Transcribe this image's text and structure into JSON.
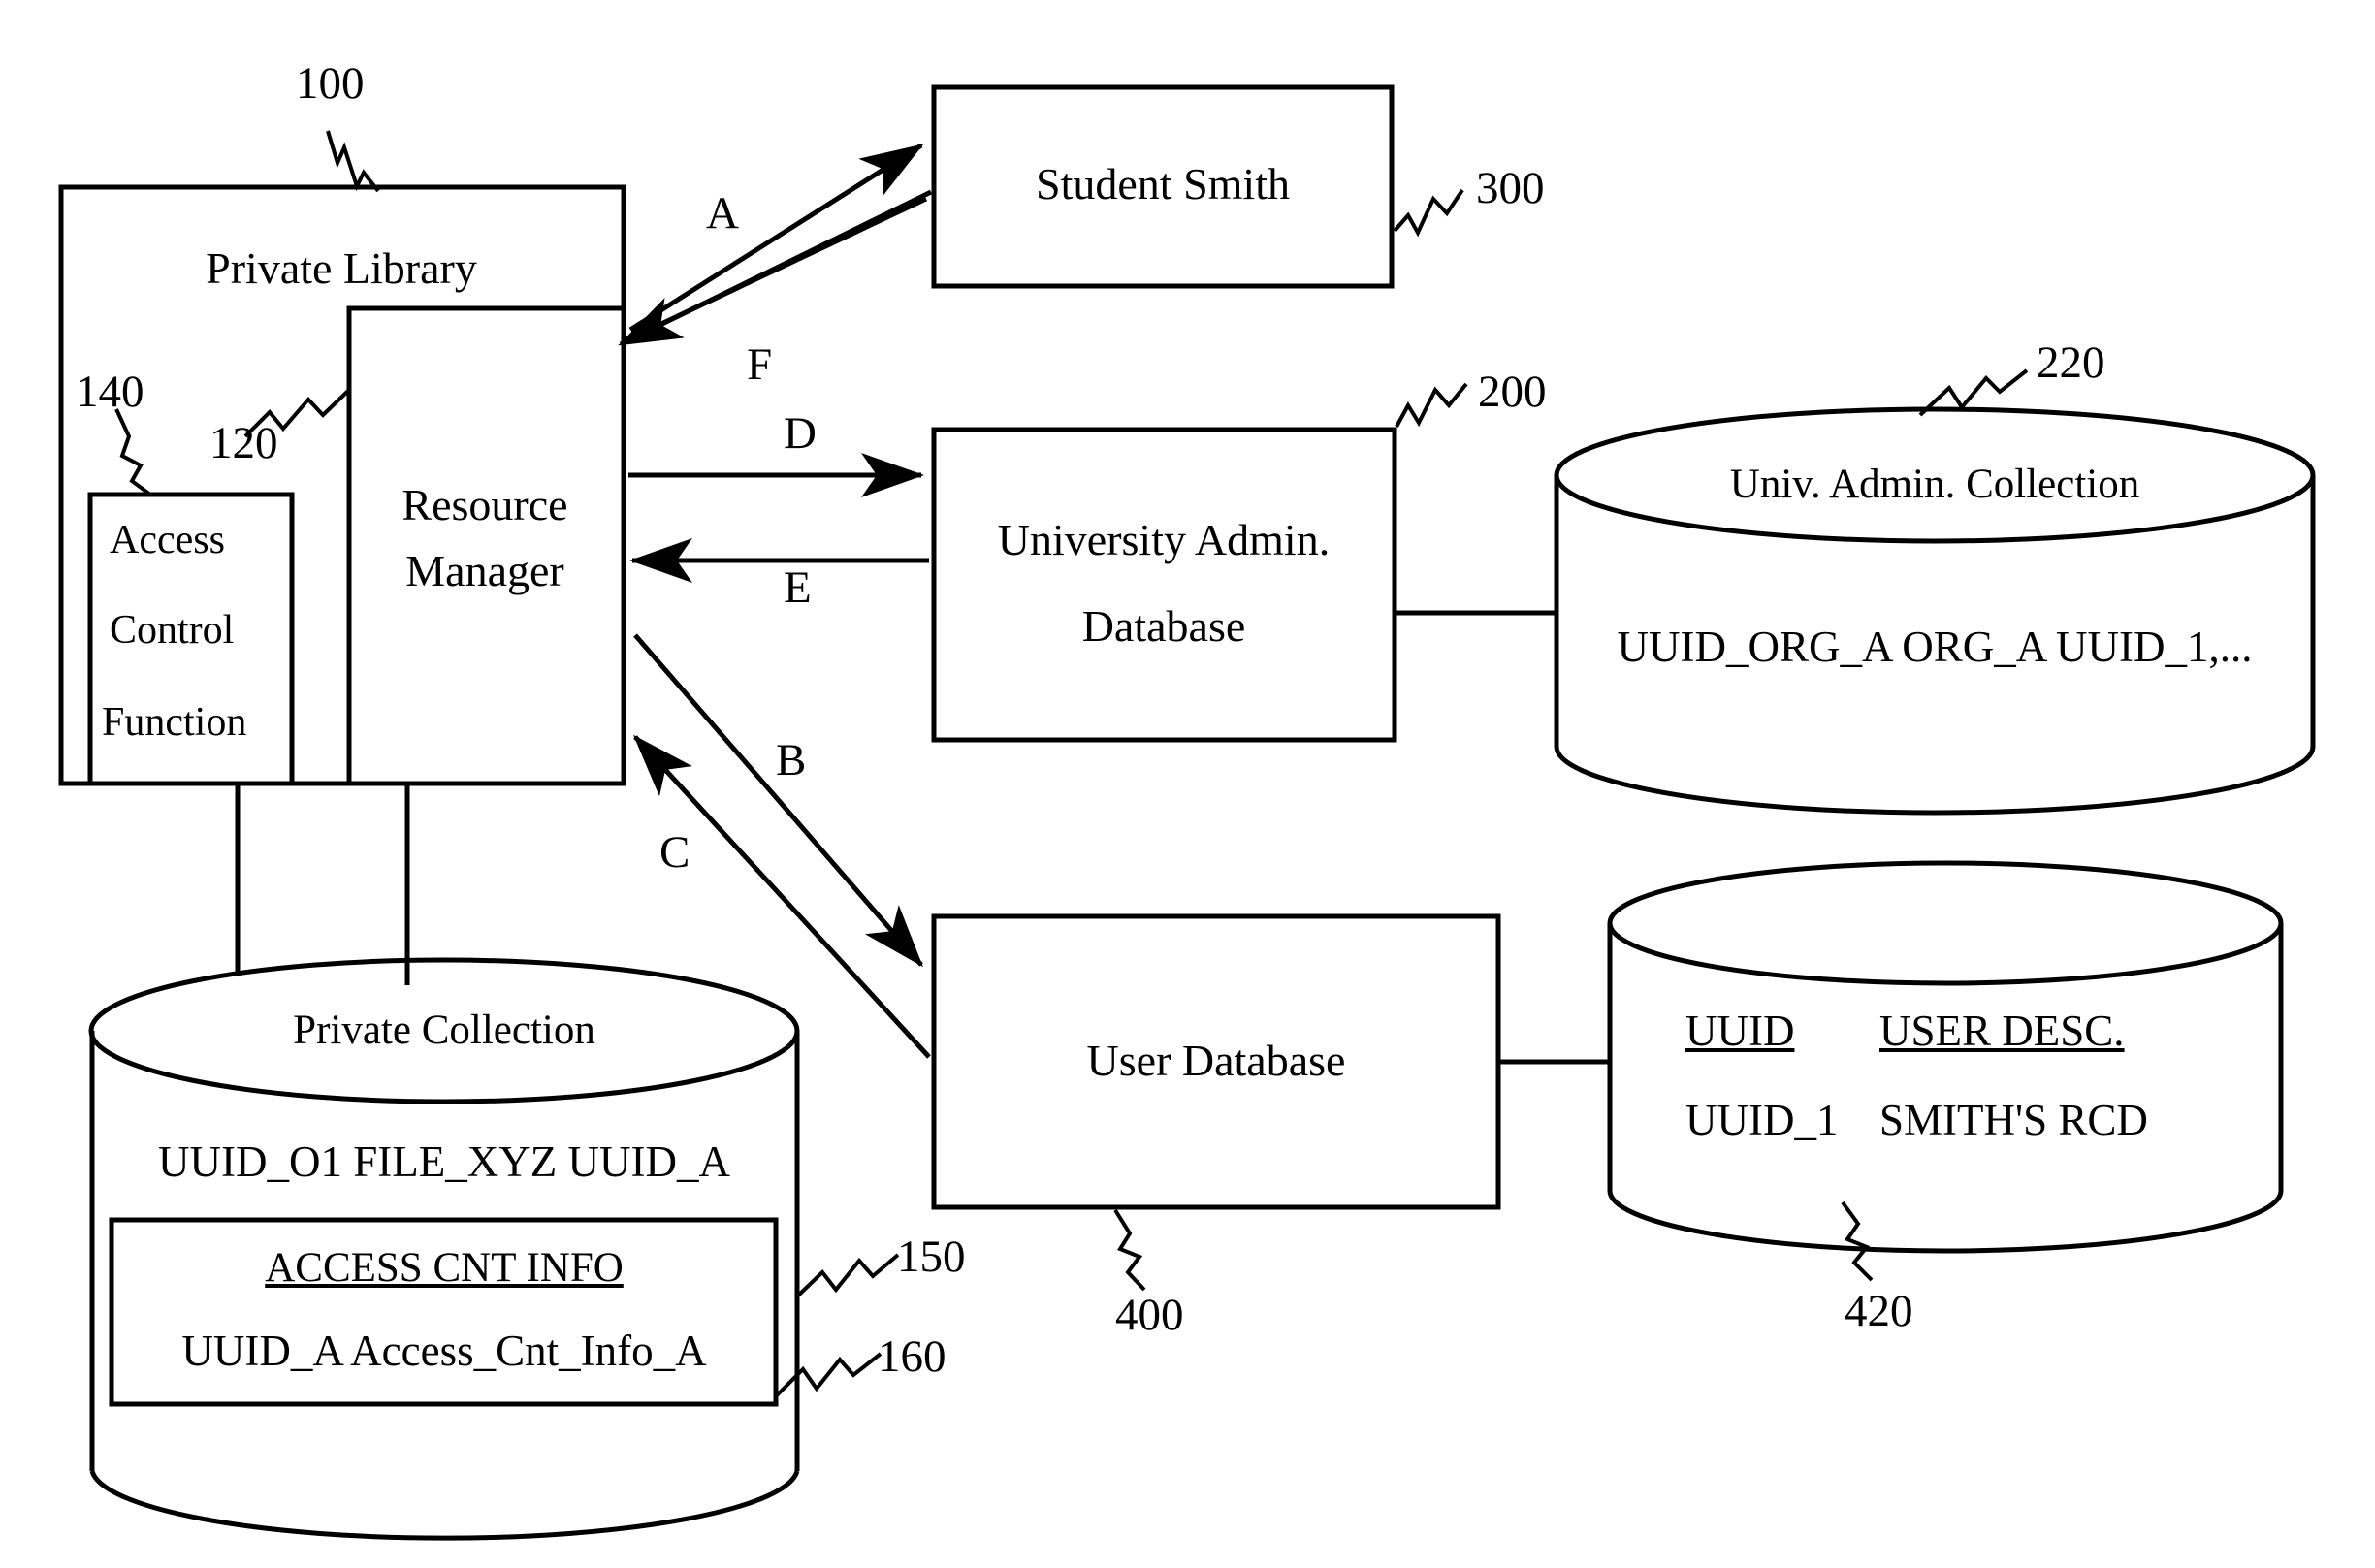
{
  "figure": {
    "type": "patent-block-diagram",
    "background": "#ffffff",
    "stroke": "#000000"
  },
  "nodes": {
    "private_library": {
      "label": "Private Library",
      "ref": "100"
    },
    "resource_manager": {
      "label_line1": "Resource",
      "label_line2": "Manager",
      "ref": "120"
    },
    "access_control_function": {
      "label_line1": "Access",
      "label_line2": "Control",
      "label_line3": "Function",
      "ref": "140"
    },
    "student_smith": {
      "label": "Student Smith",
      "ref": "300"
    },
    "university_admin_database": {
      "label_line1": "University Admin.",
      "label_line2": "Database",
      "ref": "200"
    },
    "univ_admin_collection": {
      "title": "Univ. Admin. Collection",
      "row": "UUID_ORG_A  ORG_A  UUID_1,...",
      "ref": "220"
    },
    "user_database": {
      "label": "User Database",
      "ref": "400"
    },
    "user_records_store": {
      "col1_header": "UUID",
      "col2_header": "USER DESC.",
      "col1_value": "UUID_1",
      "col2_value": "SMITH'S RCD",
      "ref": "420"
    },
    "private_collection": {
      "title": "Private Collection",
      "row": "UUID_O1  FILE_XYZ  UUID_A",
      "ref": "150",
      "access_cnt_info": {
        "header": "ACCESS CNT INFO",
        "row": "UUID_A  Access_Cnt_Info_A",
        "ref": "160"
      }
    }
  },
  "arrows": [
    {
      "id": "A",
      "label": "A",
      "from": "private_library",
      "to": "student_smith"
    },
    {
      "id": "F",
      "label": "F",
      "from": "student_smith",
      "to": "private_library"
    },
    {
      "id": "D",
      "label": "D",
      "from": "resource_manager",
      "to": "university_admin_database"
    },
    {
      "id": "E",
      "label": "E",
      "from": "university_admin_database",
      "to": "resource_manager"
    },
    {
      "id": "B",
      "label": "B",
      "from": "resource_manager",
      "to": "user_database"
    },
    {
      "id": "C",
      "label": "C",
      "from": "user_database",
      "to": "resource_manager"
    }
  ]
}
